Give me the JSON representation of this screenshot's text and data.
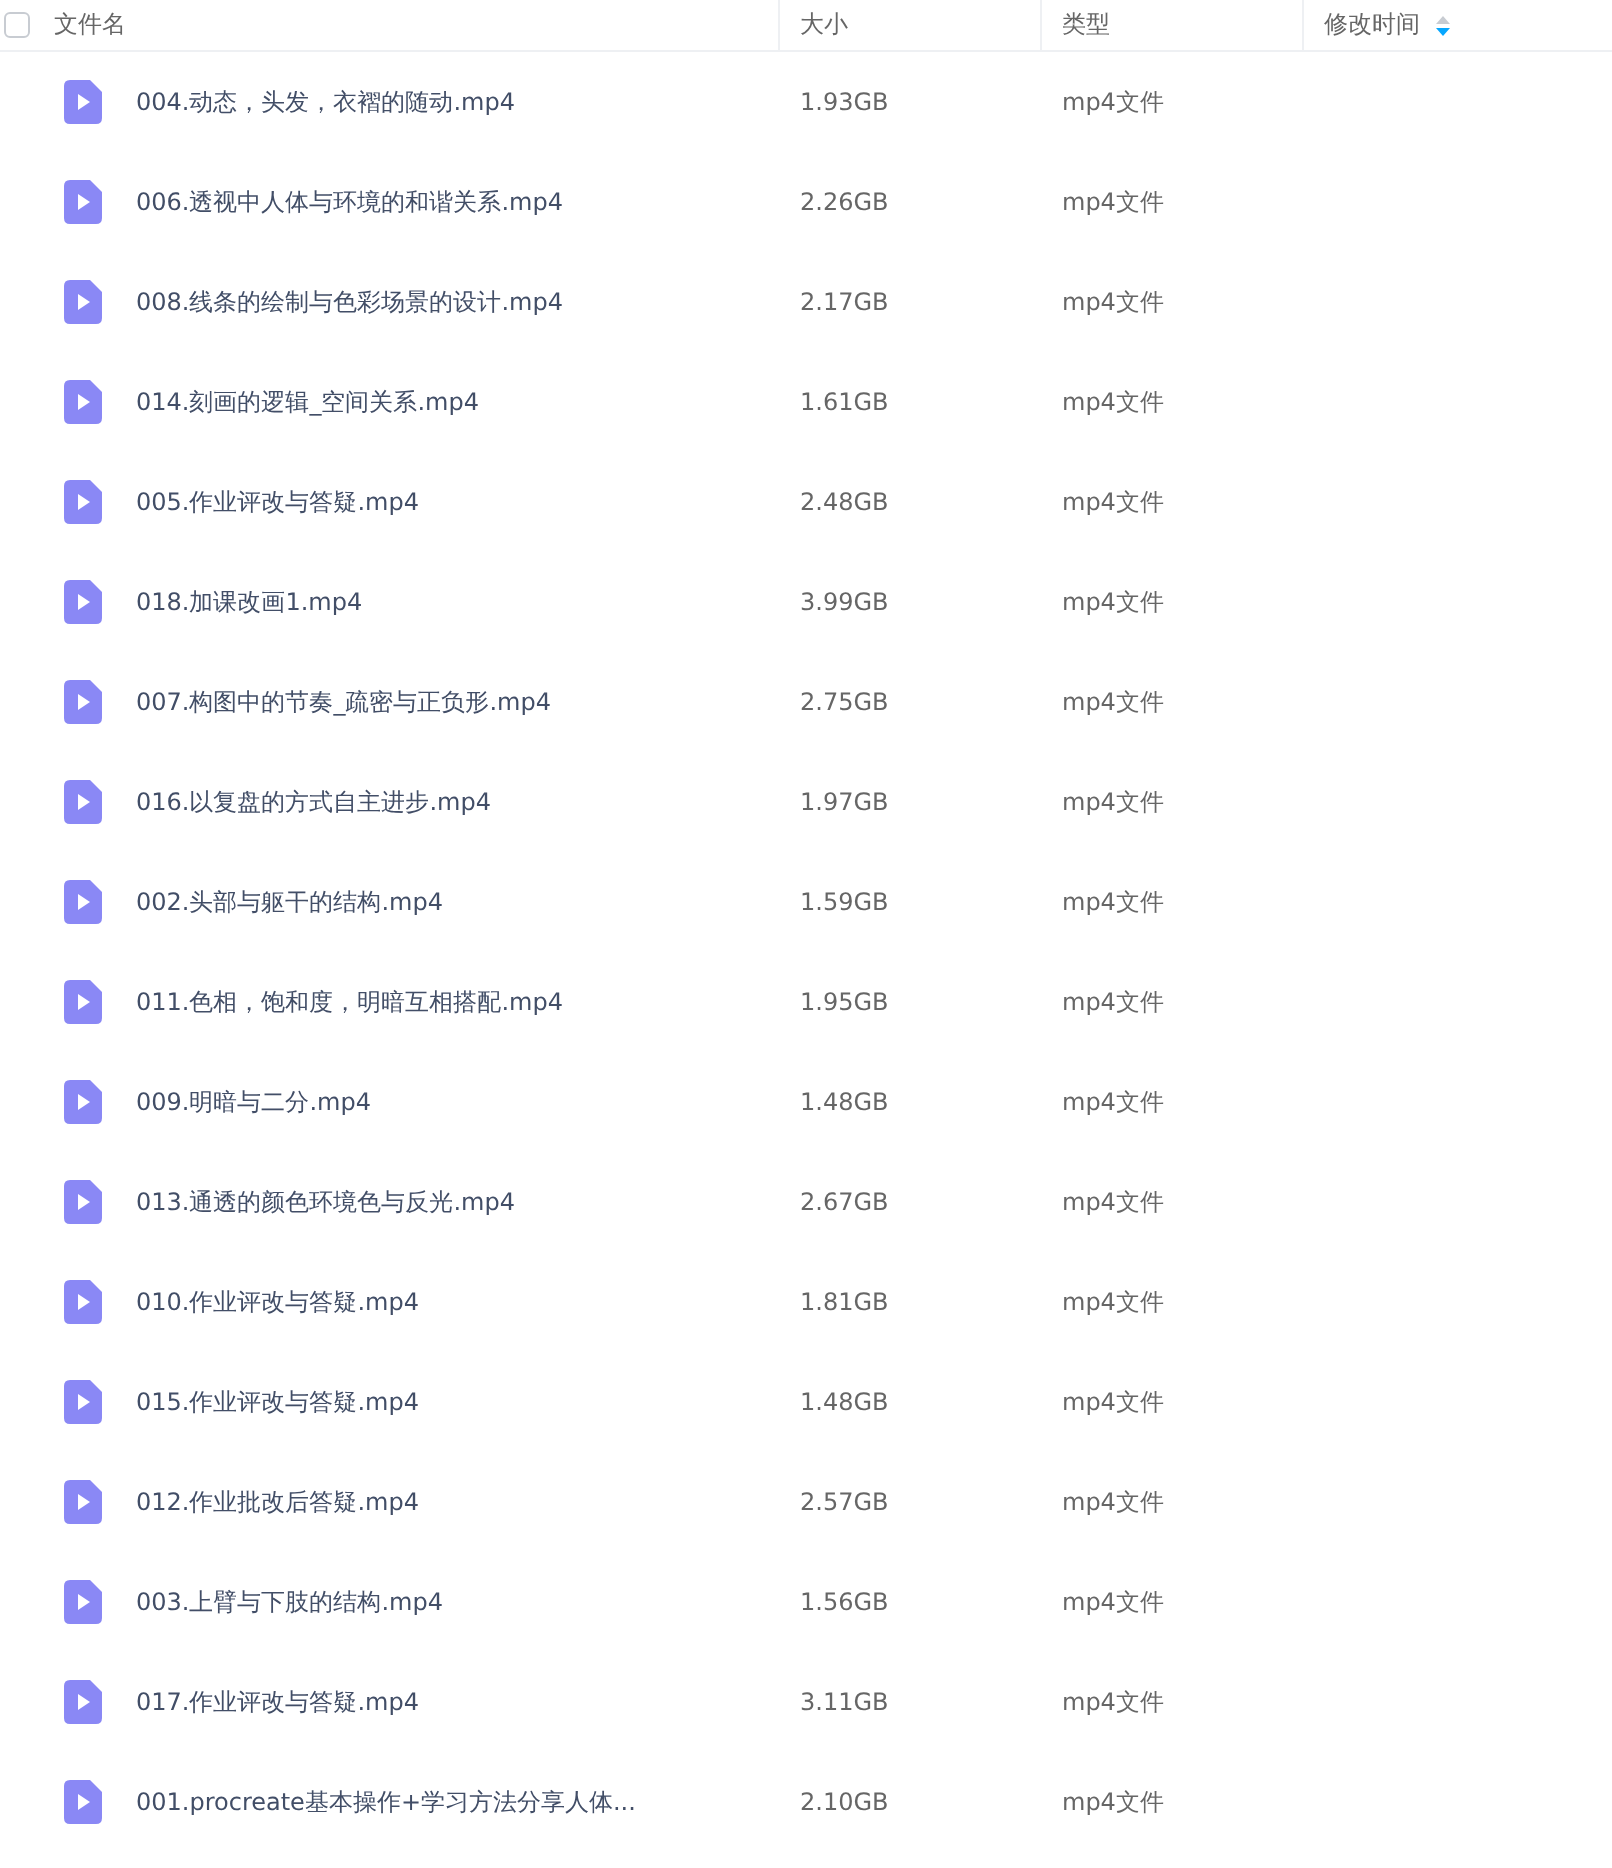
{
  "table": {
    "select_all": {
      "checked": false
    },
    "columns": [
      "文件名",
      "大小",
      "类型",
      "修改时间"
    ],
    "rows": [
      {
        "name": "004.动态，头发，衣褶的随动.mp4",
        "size": "1.93GB",
        "type": "mp4文件"
      },
      {
        "name": "006.透视中人体与环境的和谐关系.mp4",
        "size": "2.26GB",
        "type": "mp4文件"
      },
      {
        "name": "008.线条的绘制与色彩场景的设计.mp4",
        "size": "2.17GB",
        "type": "mp4文件"
      },
      {
        "name": "014.刻画的逻辑_空间关系.mp4",
        "size": "1.61GB",
        "type": "mp4文件"
      },
      {
        "name": "005.作业评改与答疑.mp4",
        "size": "2.48GB",
        "type": "mp4文件"
      },
      {
        "name": "018.加课改画1.mp4",
        "size": "3.99GB",
        "type": "mp4文件"
      },
      {
        "name": "007.构图中的节奏_疏密与正负形.mp4",
        "size": "2.75GB",
        "type": "mp4文件"
      },
      {
        "name": "016.以复盘的方式自主进步.mp4",
        "size": "1.97GB",
        "type": "mp4文件"
      },
      {
        "name": "002.头部与躯干的结构.mp4",
        "size": "1.59GB",
        "type": "mp4文件"
      },
      {
        "name": "011.色相，饱和度，明暗互相搭配.mp4",
        "size": "1.95GB",
        "type": "mp4文件"
      },
      {
        "name": "009.明暗与二分.mp4",
        "size": "1.48GB",
        "type": "mp4文件"
      },
      {
        "name": "013.通透的颜色环境色与反光.mp4",
        "size": "2.67GB",
        "type": "mp4文件"
      },
      {
        "name": "010.作业评改与答疑.mp4",
        "size": "1.81GB",
        "type": "mp4文件"
      },
      {
        "name": "015.作业评改与答疑.mp4",
        "size": "1.48GB",
        "type": "mp4文件"
      },
      {
        "name": "012.作业批改后答疑.mp4",
        "size": "2.57GB",
        "type": "mp4文件"
      },
      {
        "name": "003.上臂与下肢的结构.mp4",
        "size": "1.56GB",
        "type": "mp4文件"
      },
      {
        "name": "017.作业评改与答疑.mp4",
        "size": "3.11GB",
        "type": "mp4文件"
      },
      {
        "name": "001.procreate基本操作+学习方法分享人体...",
        "size": "2.10GB",
        "type": "mp4文件"
      }
    ]
  }
}
